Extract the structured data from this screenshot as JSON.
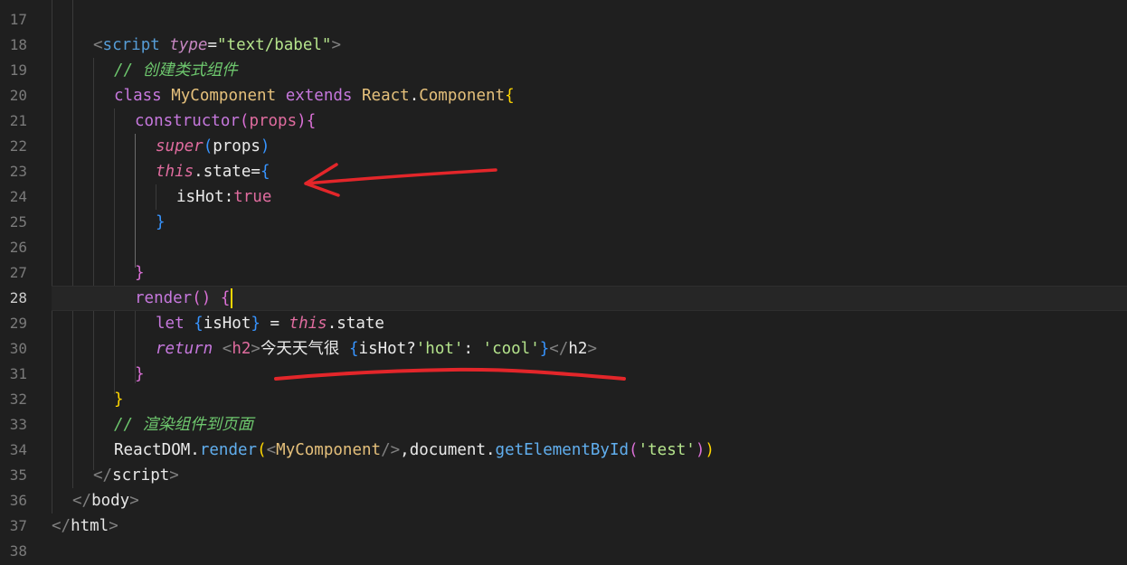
{
  "editor": {
    "active_line": "28",
    "line_numbers": [
      "17",
      "18",
      "19",
      "20",
      "21",
      "22",
      "23",
      "24",
      "25",
      "26",
      "27",
      "28",
      "29",
      "30",
      "31",
      "32",
      "33",
      "34",
      "35",
      "36",
      "37",
      "38"
    ],
    "colors": {
      "background": "#1f1f1f",
      "annotation_red": "#e3262a"
    },
    "code": {
      "l18": {
        "lt": "<",
        "tag": "script",
        "attr": "type",
        "eq": "=",
        "val": "\"text/babel\"",
        "gt": ">"
      },
      "l19": {
        "comment": "// 创建类式组件"
      },
      "l20": {
        "kw": "class",
        "name": "MyComponent",
        "ext": "extends",
        "react": "React",
        "dot": ".",
        "comp": "Component",
        "brace": "{"
      },
      "l21": {
        "fn": "constructor",
        "open": "(",
        "arg": "props",
        "close": ")",
        "brace": "{"
      },
      "l22": {
        "kw": "super",
        "open": "(",
        "arg": "props",
        "close": ")"
      },
      "l23": {
        "kw": "this",
        "dot": ".",
        "prop": "state",
        "eq": "=",
        "brace": "{"
      },
      "l24": {
        "key": "isHot",
        "colon": ":",
        "val": "true"
      },
      "l25": {
        "brace": "}"
      },
      "l27": {
        "brace": "}"
      },
      "l28": {
        "fn": "render",
        "parens": "()",
        "brace": "{"
      },
      "l29": {
        "kw": "let",
        "open": "{",
        "var": "isHot",
        "close": "}",
        "eq": " = ",
        "this": "this",
        "dot": ".",
        "prop": "state"
      },
      "l30": {
        "kw": "return",
        "lt": "<",
        "tag": "h2",
        "gt": ">",
        "text": "今天天气很 ",
        "open": "{",
        "cond": "isHot",
        "q": "?",
        "s1": "'hot'",
        "colon": ": ",
        "s2": "'cool'",
        "close": "}",
        "lt2": "</",
        "tag2": "h2",
        "gt2": ">"
      },
      "l31": {
        "brace": "}"
      },
      "l32": {
        "brace": "}"
      },
      "l33": {
        "comment": "// 渲染组件到页面"
      },
      "l34": {
        "obj": "ReactDOM",
        "dot": ".",
        "fn": "render",
        "open": "(",
        "lt": "<",
        "comp": "MyComponent",
        "sc": "/>",
        "comma": ",",
        "doc": "document",
        "dot2": ".",
        "method": "getElementById",
        "open2": "(",
        "str": "'test'",
        "close2": ")",
        "close": ")"
      },
      "l35": {
        "lt": "</",
        "tag": "script",
        "gt": ">"
      },
      "l36": {
        "lt": "</",
        "tag": "body",
        "gt": ">"
      },
      "l37": {
        "lt": "</",
        "tag": "html",
        "gt": ">"
      }
    }
  }
}
